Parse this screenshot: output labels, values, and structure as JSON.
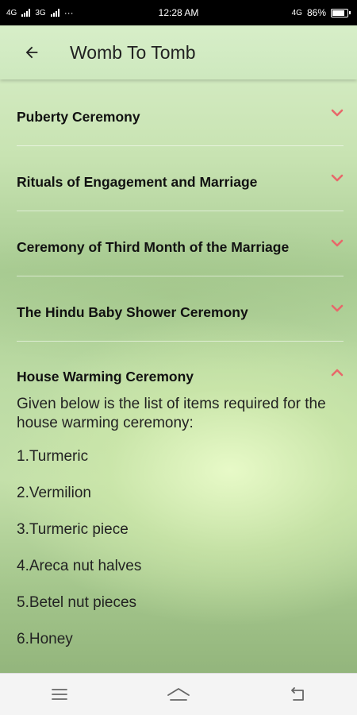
{
  "status_bar": {
    "left": "4G",
    "left2": "3G",
    "dots": "···",
    "time": "12:28 AM",
    "right_network": "4G",
    "battery": "86%",
    "battery_level": 0.86
  },
  "app_bar": {
    "title": "Womb To Tomb",
    "back_icon": "arrow-left-icon"
  },
  "sections": [
    {
      "title": "Puberty Ceremony",
      "expanded": false
    },
    {
      "title": "Rituals of Engagement and Marriage",
      "expanded": false
    },
    {
      "title": "Ceremony of Third Month of the Marriage",
      "expanded": false
    },
    {
      "title": "The Hindu Baby Shower Ceremony",
      "expanded": false
    },
    {
      "title": "House Warming Ceremony",
      "expanded": true
    }
  ],
  "expanded_content": {
    "intro": "Given below is the list of items required for the house warming ceremony:",
    "items": [
      "1.Turmeric",
      "2.Vermilion",
      "3.Turmeric piece",
      "4.Areca nut halves",
      "5.Betel nut pieces",
      "6.Honey"
    ]
  },
  "colors": {
    "chevron": "#e8686a",
    "status_bar": "#000000",
    "nav_bar": "#f4f4f4"
  },
  "nav_bar": {
    "menu_icon": "menu-icon",
    "home_icon": "home-icon",
    "back_icon": "back-return-icon"
  }
}
